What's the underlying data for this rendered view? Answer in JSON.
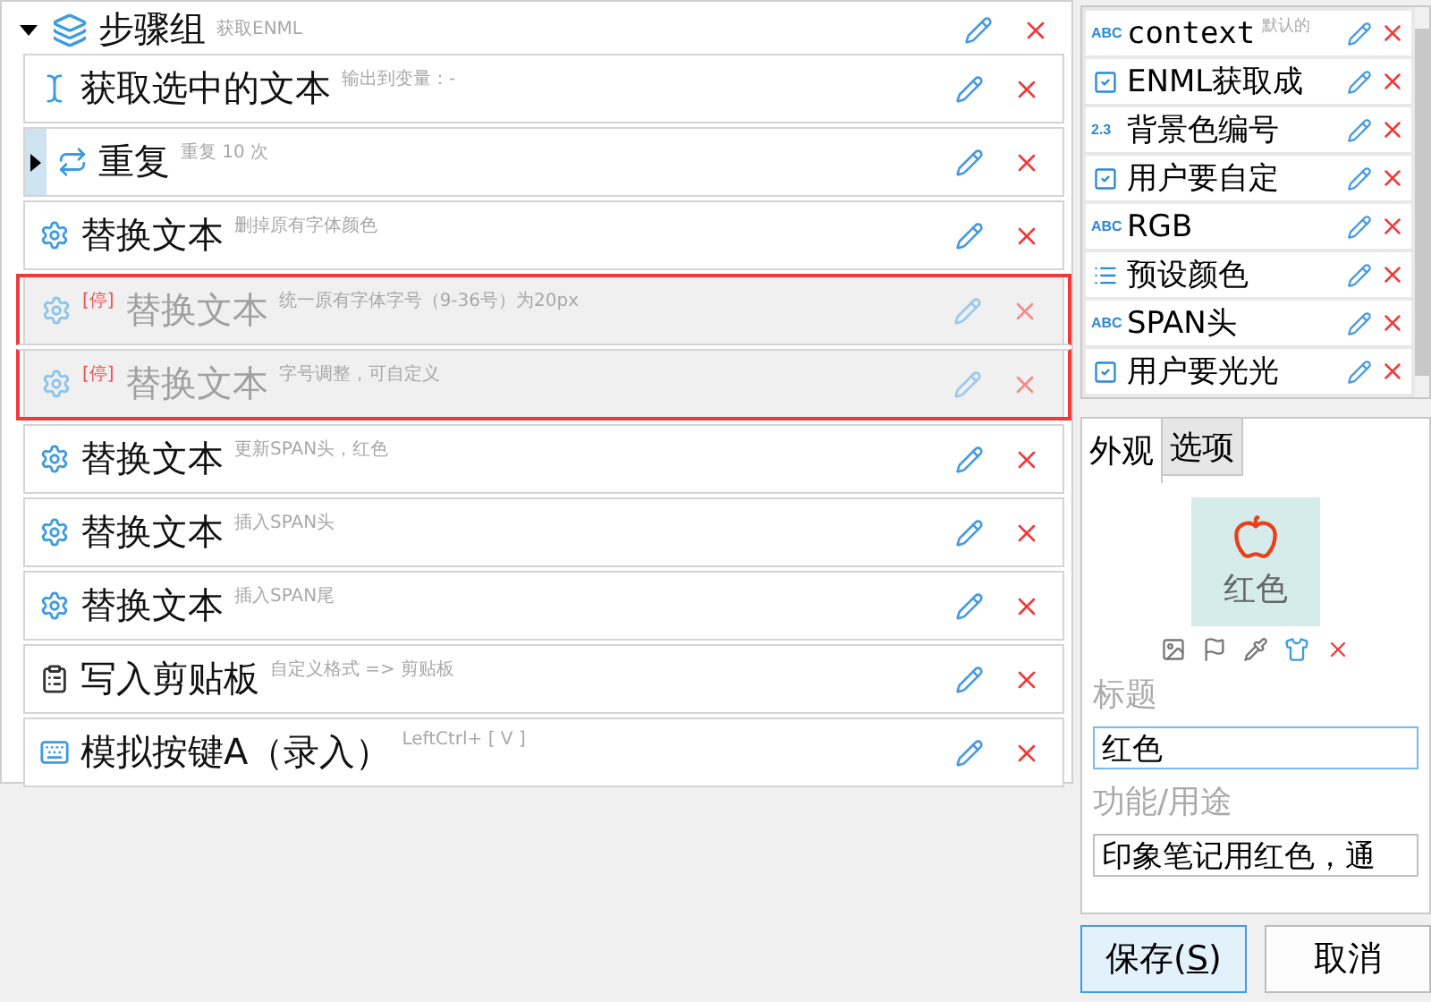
{
  "group": {
    "title": "步骤组",
    "hint": "获取ENML",
    "expanded": true
  },
  "steps": [
    {
      "kind": "text-cursor",
      "title": "获取选中的文本",
      "hint": "输出到变量：-",
      "disabled": false,
      "selected": false
    },
    {
      "kind": "loop",
      "title": "重复",
      "hint": "重复 10 次",
      "disabled": false,
      "selected": false,
      "expanded": false
    },
    {
      "kind": "gear",
      "title": "替换文本",
      "hint": "删掉原有字体颜色",
      "disabled": false,
      "selected": false
    },
    {
      "kind": "gear",
      "tag": "[停]",
      "title": "替换文本",
      "hint": "统一原有字体字号（9-36号）为20px",
      "disabled": true,
      "selected": true
    },
    {
      "kind": "gear",
      "tag": "[停]",
      "title": "替换文本",
      "hint": "字号调整，可自定义",
      "disabled": true,
      "selected": true
    },
    {
      "kind": "gear",
      "title": "替换文本",
      "hint": "更新SPAN头，红色",
      "disabled": false,
      "selected": false
    },
    {
      "kind": "gear",
      "title": "替换文本",
      "hint": "插入SPAN头",
      "disabled": false,
      "selected": false
    },
    {
      "kind": "gear",
      "title": "替换文本",
      "hint": "插入SPAN尾",
      "disabled": false,
      "selected": false
    },
    {
      "kind": "clipboard",
      "title": "写入剪贴板",
      "hint": "自定义格式 => 剪贴板",
      "disabled": false,
      "selected": false
    },
    {
      "kind": "keyboard",
      "title": "模拟按键A（录入）",
      "hint": "LeftCtrl+ [ V ]",
      "disabled": false,
      "selected": false
    }
  ],
  "variables": [
    {
      "kind": "text",
      "type_badge": "ABC",
      "name": "context",
      "hint": "默认的"
    },
    {
      "kind": "bool",
      "name": "ENML获取成"
    },
    {
      "kind": "number",
      "type_badge": "2.3",
      "name": "背景色编号"
    },
    {
      "kind": "bool",
      "name": "用户要自定"
    },
    {
      "kind": "text",
      "type_badge": "ABC",
      "name": "RGB"
    },
    {
      "kind": "list",
      "name": "预设颜色"
    },
    {
      "kind": "text",
      "type_badge": "ABC",
      "name": "SPAN头"
    },
    {
      "kind": "bool",
      "name": "用户要光光"
    }
  ],
  "tabs": [
    {
      "label": "外观",
      "selected": true
    },
    {
      "label": "选项",
      "selected": false
    }
  ],
  "appearance": {
    "tile_label": "红色",
    "title_label": "标题",
    "title_value": "红色",
    "purpose_label": "功能/用途",
    "purpose_value": "印象笔记用红色，通"
  },
  "buttons": [
    {
      "label_parts": [
        "保存(",
        "S",
        ")"
      ],
      "default": true
    },
    {
      "label_parts": [
        "取消"
      ],
      "default": false
    }
  ]
}
